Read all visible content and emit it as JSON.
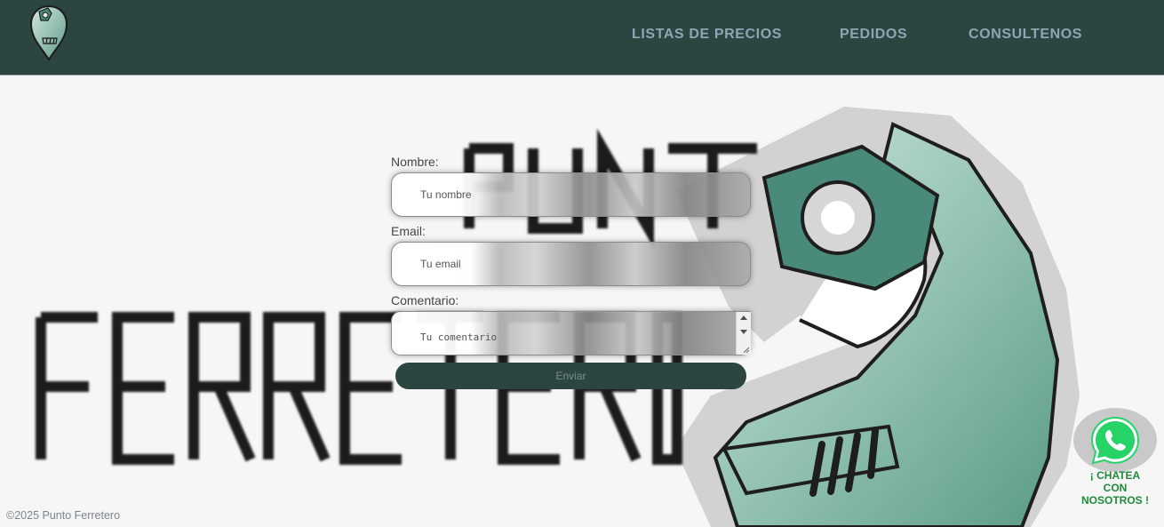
{
  "header": {
    "logo_icon": "wrench-pin-logo-icon",
    "nav": [
      {
        "label": "LISTAS DE PRECIOS"
      },
      {
        "label": "PEDIDOS"
      },
      {
        "label": "CONSULTENOS"
      }
    ]
  },
  "background": {
    "word_top": "PUNT",
    "word_bottom": "FERRETERO",
    "icon": "wrench-nut-icon"
  },
  "form": {
    "name_label": "Nombre:",
    "name_placeholder": "Tu nombre",
    "email_label": "Email:",
    "email_placeholder": "Tu email",
    "comment_label": "Comentario:",
    "comment_placeholder": "Tu comentario",
    "submit_label": "Enviar"
  },
  "whatsapp": {
    "icon": "whatsapp-icon",
    "line1": "¡ CHATEA",
    "line2": "CON",
    "line3": "NOSOTROS !"
  },
  "footer": {
    "text": "©2025 Punto Ferretero"
  },
  "colors": {
    "header_bg": "#2c4540",
    "nav_text": "#8ea5b3",
    "page_bg": "#f6f6f6",
    "brand_green": "#4a8a7a",
    "whatsapp_green": "#1e8a3a"
  }
}
